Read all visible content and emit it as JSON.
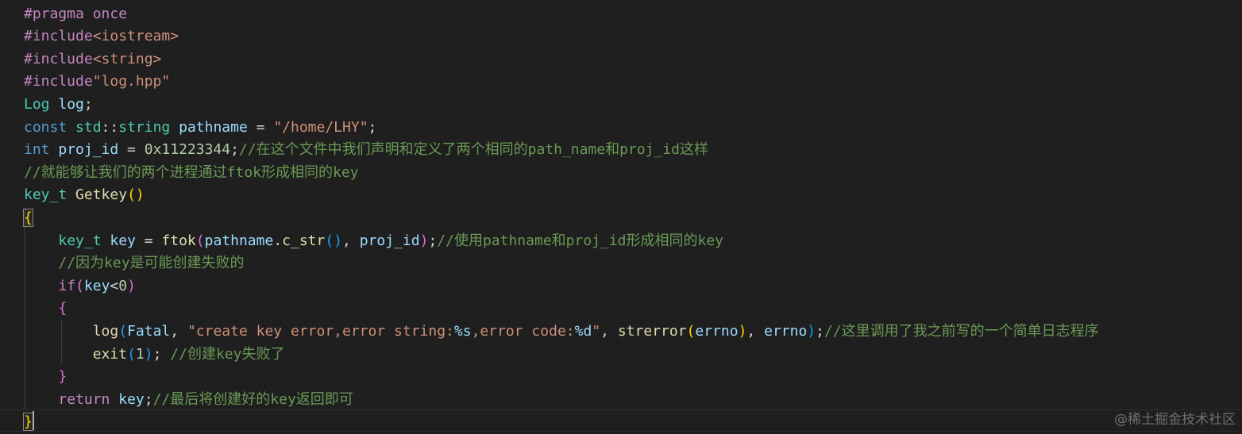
{
  "editor": {
    "lines": [
      [
        {
          "t": "#pragma once",
          "c": "#c586c0"
        }
      ],
      [
        {
          "t": "#include",
          "c": "#c586c0"
        },
        {
          "t": "<iostream>",
          "c": "#ce9178"
        }
      ],
      [
        {
          "t": "#include",
          "c": "#c586c0"
        },
        {
          "t": "<string>",
          "c": "#ce9178"
        }
      ],
      [
        {
          "t": "#include",
          "c": "#c586c0"
        },
        {
          "t": "\"log.hpp\"",
          "c": "#ce9178"
        }
      ],
      [
        {
          "t": "Log",
          "c": "#4ec9b0"
        },
        {
          "t": " ",
          "c": "#d4d4d4"
        },
        {
          "t": "log",
          "c": "#9cdcfe"
        },
        {
          "t": ";",
          "c": "#d4d4d4"
        }
      ],
      [
        {
          "t": "const",
          "c": "#569cd6"
        },
        {
          "t": " ",
          "c": "#d4d4d4"
        },
        {
          "t": "std",
          "c": "#4ec9b0"
        },
        {
          "t": "::",
          "c": "#d4d4d4"
        },
        {
          "t": "string",
          "c": "#4ec9b0"
        },
        {
          "t": " ",
          "c": "#d4d4d4"
        },
        {
          "t": "pathname",
          "c": "#9cdcfe"
        },
        {
          "t": " = ",
          "c": "#d4d4d4"
        },
        {
          "t": "\"/home/LHY\"",
          "c": "#ce9178"
        },
        {
          "t": ";",
          "c": "#d4d4d4"
        }
      ],
      [
        {
          "t": "int",
          "c": "#569cd6"
        },
        {
          "t": " ",
          "c": "#d4d4d4"
        },
        {
          "t": "proj_id",
          "c": "#9cdcfe"
        },
        {
          "t": " = ",
          "c": "#d4d4d4"
        },
        {
          "t": "0x11223344",
          "c": "#b5cea8"
        },
        {
          "t": ";",
          "c": "#d4d4d4"
        },
        {
          "t": "//在这个文件中我们声明和定义了两个相同的path_name和proj_id这样",
          "c": "#6a9955"
        }
      ],
      [
        {
          "t": "//就能够让我们的两个进程通过ftok形成相同的key",
          "c": "#6a9955"
        }
      ],
      [
        {
          "t": "key_t",
          "c": "#4ec9b0"
        },
        {
          "t": " ",
          "c": "#d4d4d4"
        },
        {
          "t": "Getkey",
          "c": "#dcdcaa"
        },
        {
          "t": "()",
          "c": "#ffd700"
        }
      ],
      [
        {
          "t": "{",
          "c": "#ffd700",
          "m": true
        }
      ],
      [
        {
          "t": "    ",
          "c": "#d4d4d4"
        },
        {
          "t": "key_t",
          "c": "#4ec9b0"
        },
        {
          "t": " ",
          "c": "#d4d4d4"
        },
        {
          "t": "key",
          "c": "#9cdcfe"
        },
        {
          "t": " = ",
          "c": "#d4d4d4"
        },
        {
          "t": "ftok",
          "c": "#dcdcaa"
        },
        {
          "t": "(",
          "c": "#da70d6"
        },
        {
          "t": "pathname",
          "c": "#9cdcfe"
        },
        {
          "t": ".",
          "c": "#d4d4d4"
        },
        {
          "t": "c_str",
          "c": "#dcdcaa"
        },
        {
          "t": "()",
          "c": "#179fff"
        },
        {
          "t": ", ",
          "c": "#d4d4d4"
        },
        {
          "t": "proj_id",
          "c": "#9cdcfe"
        },
        {
          "t": ")",
          "c": "#da70d6"
        },
        {
          "t": ";",
          "c": "#d4d4d4"
        },
        {
          "t": "//使用pathname和proj_id形成相同的key",
          "c": "#6a9955"
        }
      ],
      [
        {
          "t": "    ",
          "c": "#d4d4d4"
        },
        {
          "t": "//因为key是可能创建失败的",
          "c": "#6a9955"
        }
      ],
      [
        {
          "t": "    ",
          "c": "#d4d4d4"
        },
        {
          "t": "if",
          "c": "#c586c0"
        },
        {
          "t": "(",
          "c": "#da70d6"
        },
        {
          "t": "key",
          "c": "#9cdcfe"
        },
        {
          "t": "<",
          "c": "#d4d4d4"
        },
        {
          "t": "0",
          "c": "#b5cea8"
        },
        {
          "t": ")",
          "c": "#da70d6"
        }
      ],
      [
        {
          "t": "    ",
          "c": "#d4d4d4"
        },
        {
          "t": "{",
          "c": "#da70d6"
        }
      ],
      [
        {
          "t": "        ",
          "c": "#d4d4d4"
        },
        {
          "t": "log",
          "c": "#dcdcaa"
        },
        {
          "t": "(",
          "c": "#179fff"
        },
        {
          "t": "Fatal",
          "c": "#9cdcfe"
        },
        {
          "t": ", ",
          "c": "#d4d4d4"
        },
        {
          "t": "\"create key error,error string:",
          "c": "#ce9178"
        },
        {
          "t": "%s",
          "c": "#9cdcfe"
        },
        {
          "t": ",error code:",
          "c": "#ce9178"
        },
        {
          "t": "%d",
          "c": "#9cdcfe"
        },
        {
          "t": "\"",
          "c": "#ce9178"
        },
        {
          "t": ", ",
          "c": "#d4d4d4"
        },
        {
          "t": "strerror",
          "c": "#dcdcaa"
        },
        {
          "t": "(",
          "c": "#ffd700"
        },
        {
          "t": "errno",
          "c": "#9cdcfe"
        },
        {
          "t": ")",
          "c": "#ffd700"
        },
        {
          "t": ", ",
          "c": "#d4d4d4"
        },
        {
          "t": "errno",
          "c": "#9cdcfe"
        },
        {
          "t": ")",
          "c": "#179fff"
        },
        {
          "t": ";",
          "c": "#d4d4d4"
        },
        {
          "t": "//这里调用了我之前写的一个简单日志程序",
          "c": "#6a9955"
        }
      ],
      [
        {
          "t": "        ",
          "c": "#d4d4d4"
        },
        {
          "t": "exit",
          "c": "#dcdcaa"
        },
        {
          "t": "(",
          "c": "#179fff"
        },
        {
          "t": "1",
          "c": "#b5cea8"
        },
        {
          "t": ")",
          "c": "#179fff"
        },
        {
          "t": "; ",
          "c": "#d4d4d4"
        },
        {
          "t": "//创建key失败了",
          "c": "#6a9955"
        }
      ],
      [
        {
          "t": "    ",
          "c": "#d4d4d4"
        },
        {
          "t": "}",
          "c": "#da70d6"
        }
      ],
      [
        {
          "t": "    ",
          "c": "#d4d4d4"
        },
        {
          "t": "return",
          "c": "#c586c0"
        },
        {
          "t": " ",
          "c": "#d4d4d4"
        },
        {
          "t": "key",
          "c": "#9cdcfe"
        },
        {
          "t": ";",
          "c": "#d4d4d4"
        },
        {
          "t": "//最后将创建好的key返回即可",
          "c": "#6a9955"
        }
      ],
      [
        {
          "t": "}",
          "c": "#ffd700",
          "m": true
        }
      ]
    ]
  },
  "watermark": "@稀土掘金技术社区"
}
